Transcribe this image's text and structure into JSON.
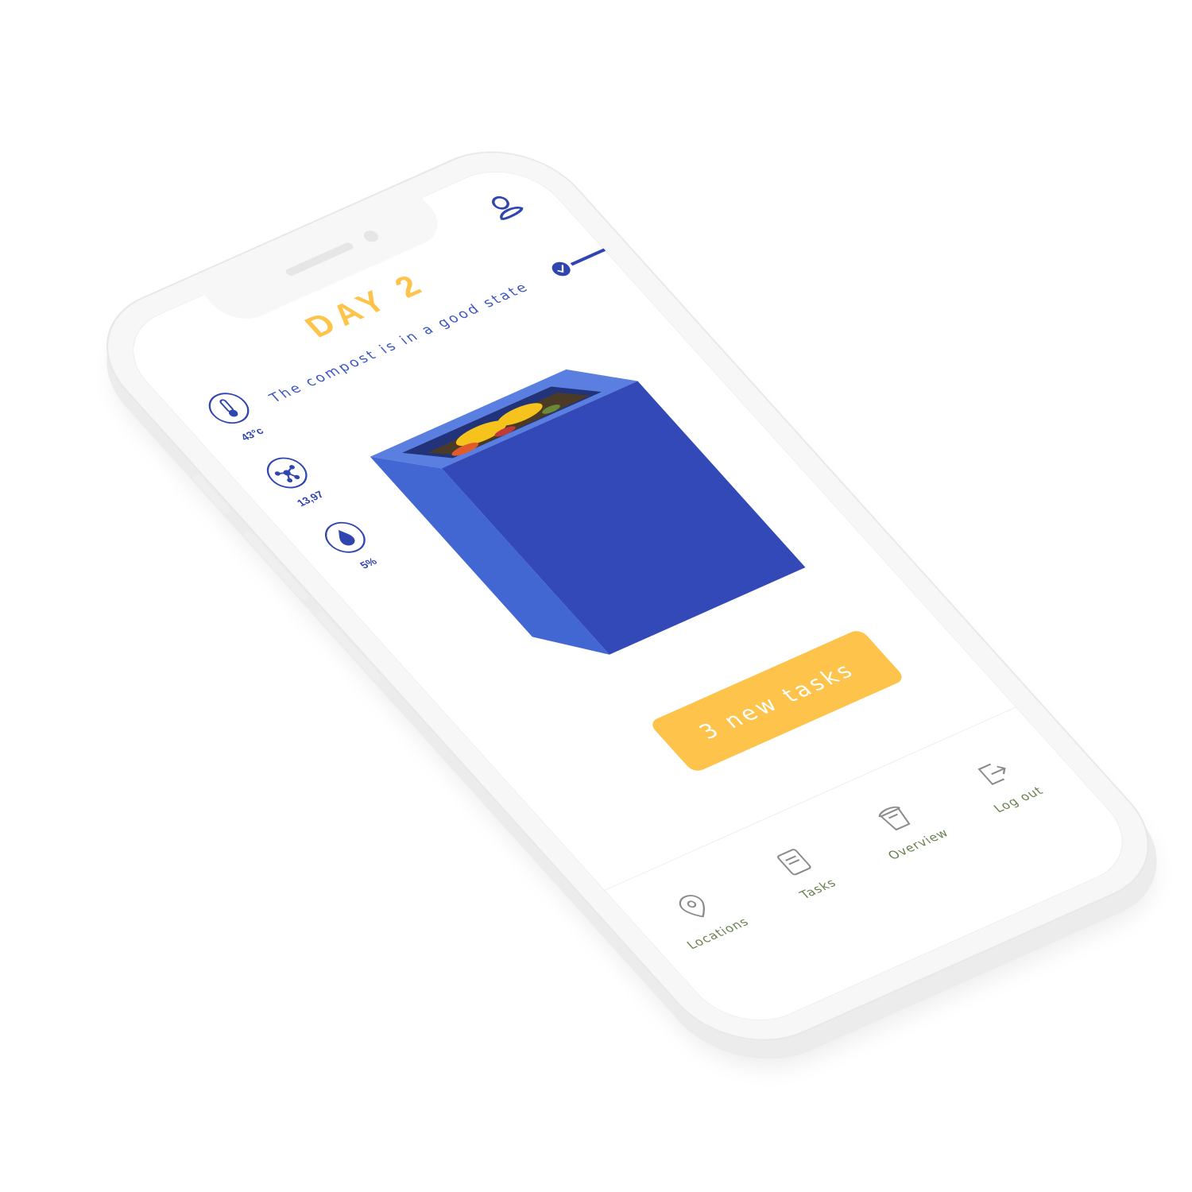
{
  "header": {
    "day_title": "DAY 2",
    "status_text": "The compost is in a good state",
    "profile_icon": "user-icon"
  },
  "metrics": [
    {
      "icon": "thermometer-icon",
      "value": "43°c"
    },
    {
      "icon": "molecule-icon",
      "value": "13,97"
    },
    {
      "icon": "water-drop-icon",
      "value": "5%"
    }
  ],
  "compost_box_icon": "compost-bin-illustration",
  "tasks_button": {
    "label": "3 new tasks"
  },
  "nav": {
    "items": [
      {
        "icon": "location-pin-icon",
        "label": "Locations"
      },
      {
        "icon": "notebook-icon",
        "label": "Tasks"
      },
      {
        "icon": "bin-icon",
        "label": "Overview"
      },
      {
        "icon": "logout-icon",
        "label": "Log out"
      }
    ]
  },
  "colors": {
    "accent_yellow": "#fdc34a",
    "accent_blue": "#3a55c4",
    "box_blue_front": "#3449b8",
    "box_blue_side": "#4267d2",
    "box_blue_top": "#5a7fe0",
    "nav_text": "#6b7f4d"
  }
}
